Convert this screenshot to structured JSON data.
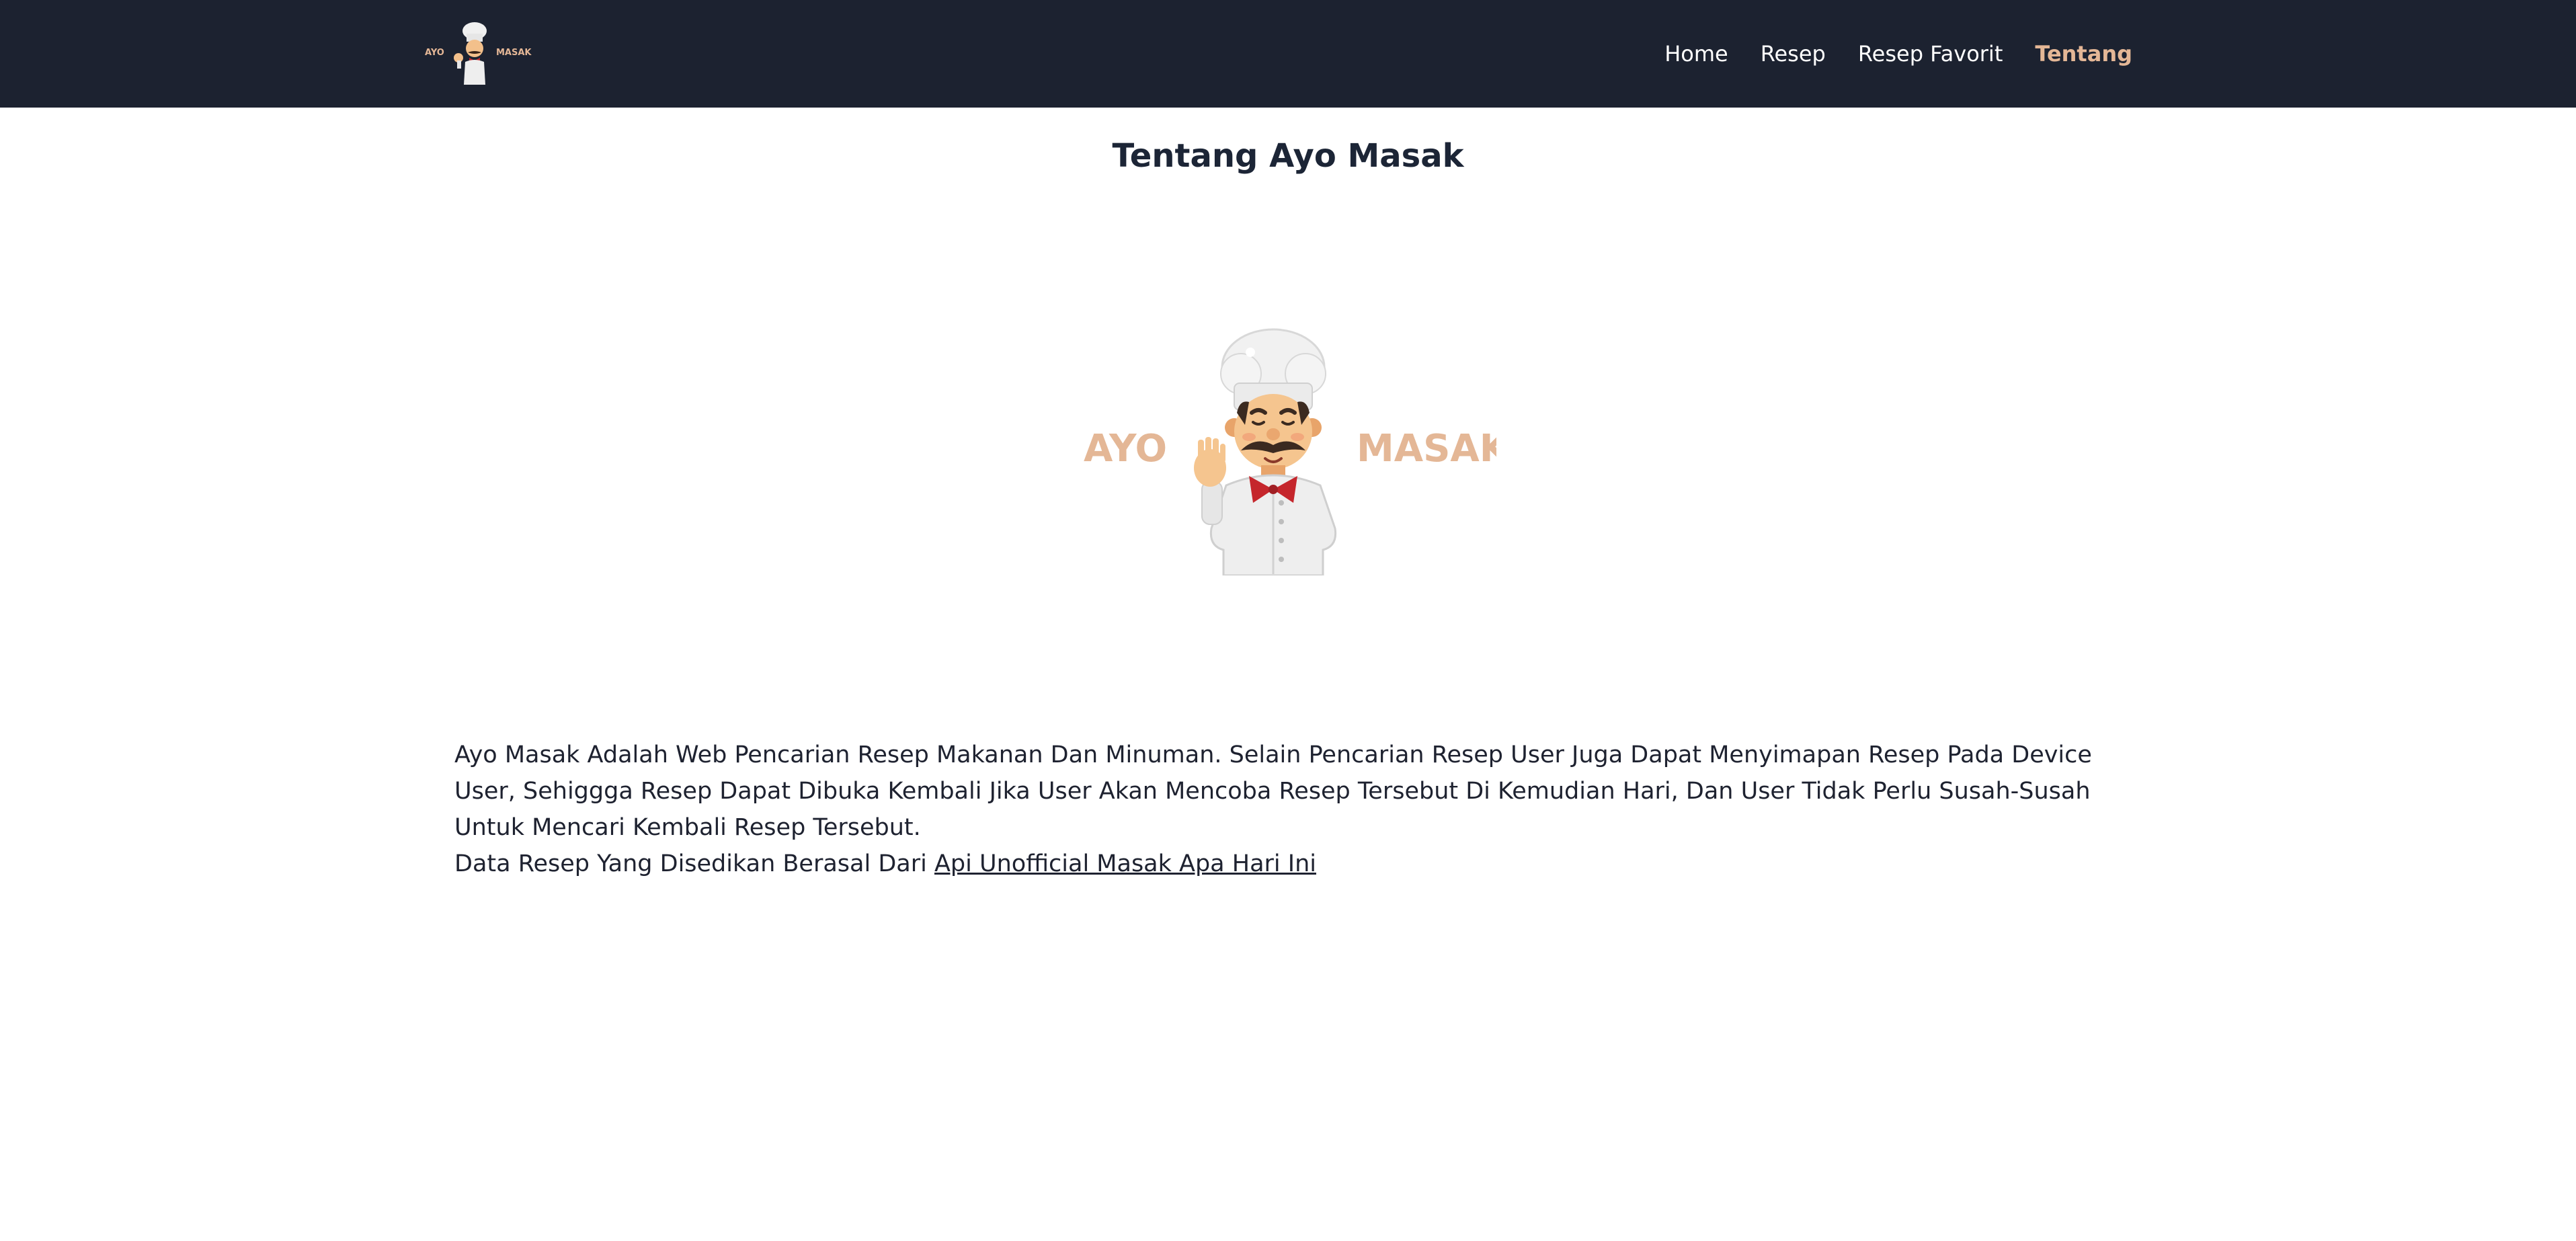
{
  "nav": {
    "logo_text_left": "AYO",
    "logo_text_right": "MASAK",
    "links": [
      {
        "label": "Home",
        "active": false
      },
      {
        "label": "Resep",
        "active": false
      },
      {
        "label": "Resep Favorit",
        "active": false
      },
      {
        "label": "Tentang",
        "active": true
      }
    ]
  },
  "page": {
    "title": "Tentang Ayo Masak",
    "hero_logo_left": "AYO",
    "hero_logo_right": "MASAK",
    "description": "Ayo Masak Adalah Web Pencarian Resep Makanan Dan Minuman. Selain Pencarian Resep User Juga Dapat Menyimapan Resep Pada Device User, Sehiggga Resep Dapat Dibuka Kembali Jika User Akan Mencoba Resep Tersebut Di Kemudian Hari, Dan User Tidak Perlu Susah-Susah Untuk Mencari Kembali Resep Tersebut.",
    "source_prefix": "Data Resep Yang Disedikan Berasal Dari ",
    "source_link_label": "Api Unofficial Masak Apa Hari Ini"
  },
  "colors": {
    "navbar_bg": "#1c2230",
    "accent": "#e4b796",
    "text_dark": "#1e2230"
  },
  "icons": {
    "brand_mascot": "chef-icon"
  }
}
